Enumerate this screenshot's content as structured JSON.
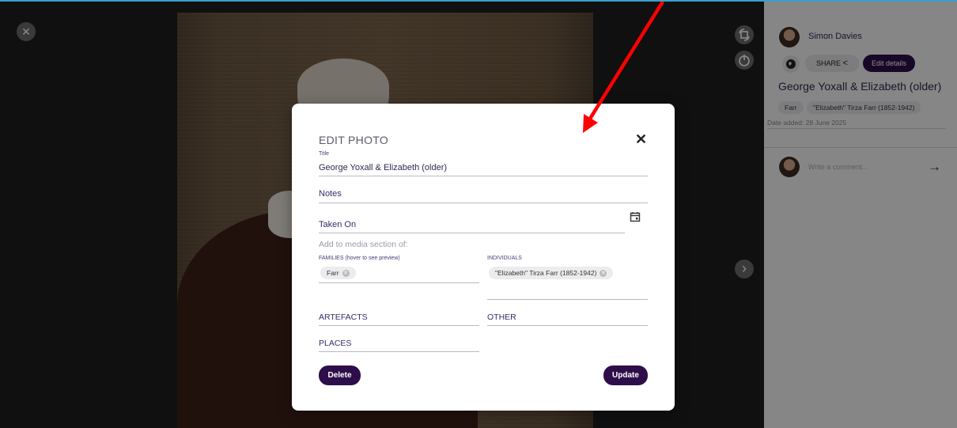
{
  "viewer": {
    "close_icon": "✕",
    "rotate_icon": "rotate-icon",
    "settings_icon": "timer-icon",
    "next_icon": "›"
  },
  "sidebar": {
    "author": "Simon Davies",
    "share_label": "SHARE",
    "edit_label": "Edit details",
    "photo_title": "George Yoxall & Elizabeth (older)",
    "tags": [
      "Farr",
      "\"Elizabeth\" Tirza Farr (1852-1942)"
    ],
    "date_added": "Date added: 28 June 2025",
    "comment_placeholder": "Write a comment...",
    "send_icon": "→"
  },
  "modal": {
    "heading": "EDIT PHOTO",
    "close_icon": "✕",
    "title_label": "Title",
    "title_value": "George Yoxall & Elizabeth (older)",
    "notes_placeholder": "Notes",
    "taken_on_placeholder": "Taken On",
    "calendar_icon": "calendar-icon",
    "media_section_label": "Add to media section of:",
    "families_label": "FAMILIES (hover to see preview)",
    "families": [
      "Farr"
    ],
    "individuals_label": "INDIVIDUALS",
    "individuals": [
      "\"Elizabeth\" Tirza Farr (1852-1942)"
    ],
    "artefacts_label": "ARTEFACTS",
    "other_label": "OTHER",
    "places_label": "PLACES",
    "delete_label": "Delete",
    "update_label": "Update"
  },
  "colors": {
    "accent": "#2e0e4a",
    "arrow": "#ff0000"
  }
}
